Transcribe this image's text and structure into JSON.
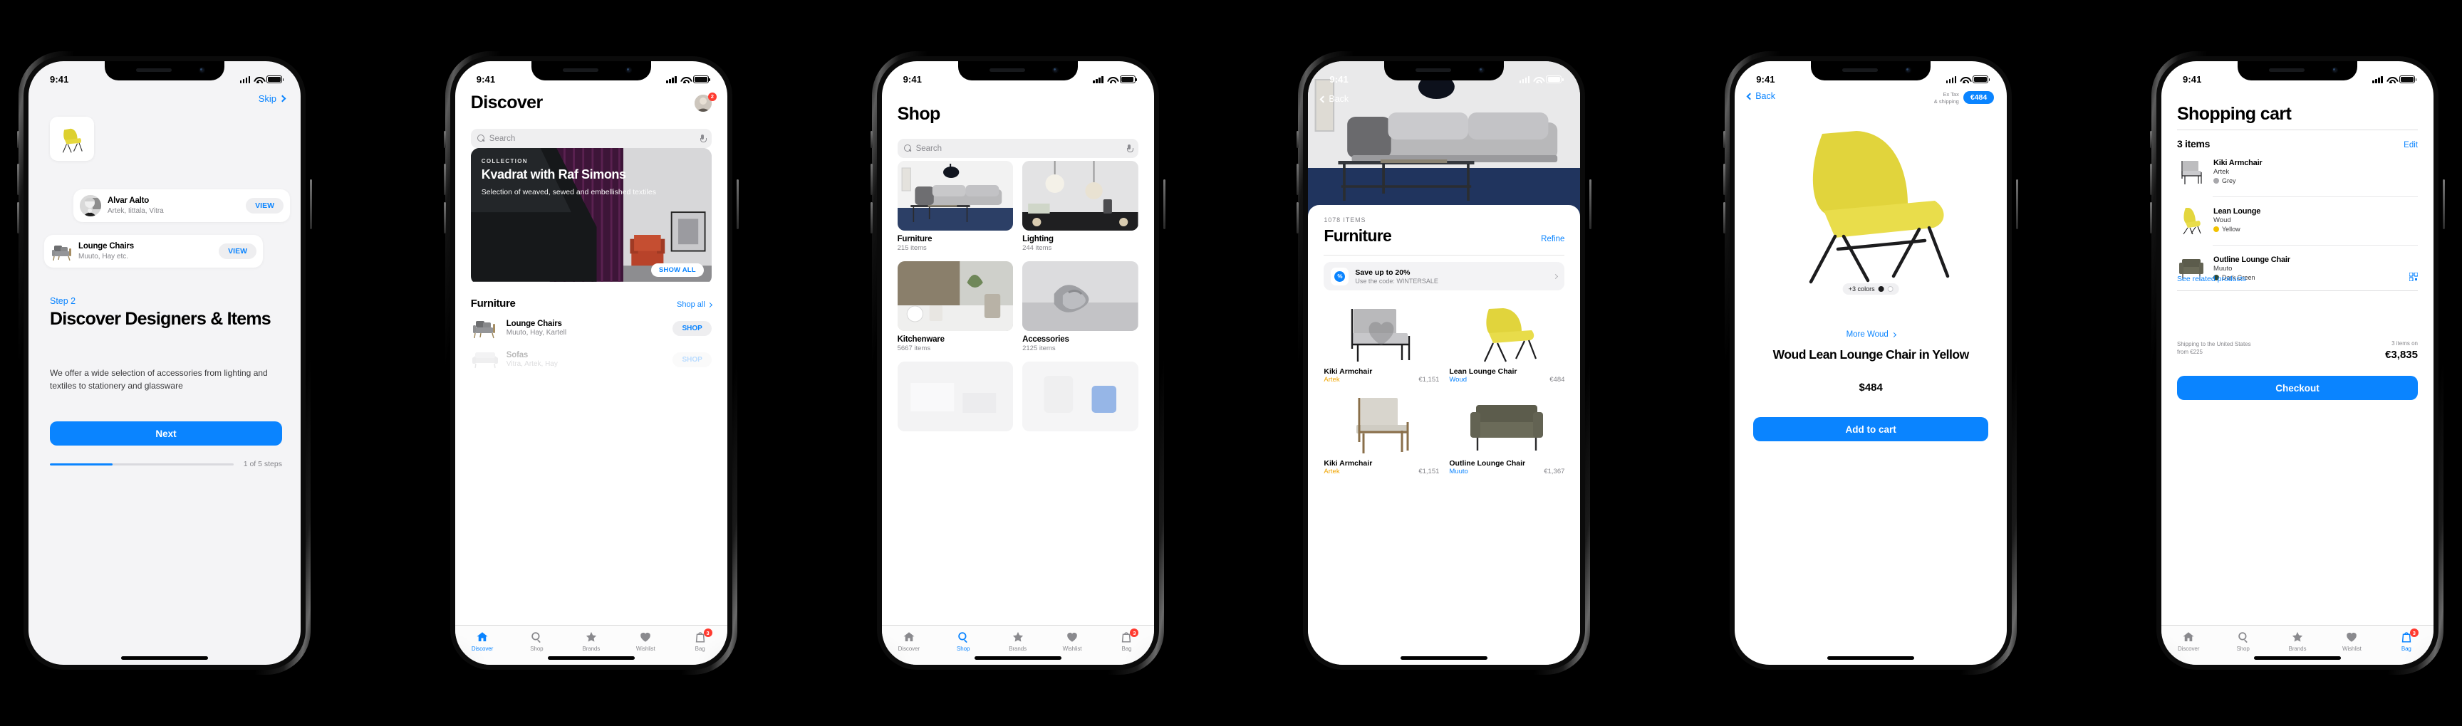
{
  "status": {
    "time": "9:41"
  },
  "phone1": {
    "skip": "Skip",
    "cards": [
      {
        "name": "Alvar Aalto",
        "sub": "Artek, Iittala, Vitra",
        "action": "VIEW"
      },
      {
        "name": "Lounge Chairs",
        "sub": "Muuto, Hay etc.",
        "action": "VIEW"
      }
    ],
    "step": "Step 2",
    "title": "Discover Designers & Items",
    "desc": "We offer a wide selection of accessories from lighting and textiles to stationery and glassware",
    "next": "Next",
    "progress_label": "1 of 5 steps",
    "progress_pct": 34
  },
  "phone2": {
    "title": "Discover",
    "search_placeholder": "Search",
    "avatar_badge": "2",
    "feature": {
      "kicker": "COLLECTION",
      "title": "Kvadrat with Raf Simons",
      "sub": "Selection of weaved, sewed and embellished textiles",
      "cta": "SHOW ALL"
    },
    "section": {
      "title": "Furniture",
      "link": "Shop all"
    },
    "rows": [
      {
        "name": "Lounge Chairs",
        "sub": "Muuto, Hay, Kartell",
        "action": "SHOP"
      },
      {
        "name": "Sofas",
        "sub": "Vitra, Artek, Hay",
        "action": "SHOP"
      }
    ],
    "tabs": [
      {
        "label": "Discover",
        "icon": "home-icon",
        "active": true
      },
      {
        "label": "Shop",
        "icon": "search-icon",
        "active": false
      },
      {
        "label": "Brands",
        "icon": "star-icon",
        "active": false
      },
      {
        "label": "Wishlist",
        "icon": "heart-icon",
        "active": false
      },
      {
        "label": "Bag",
        "icon": "bag-icon",
        "active": false,
        "badge": "3"
      }
    ]
  },
  "phone3": {
    "title": "Shop",
    "search_placeholder": "Search",
    "categories": [
      {
        "name": "Furniture",
        "count": "215 items"
      },
      {
        "name": "Lighting",
        "count": "244 items"
      },
      {
        "name": "Kitchenware",
        "count": "5667 items"
      },
      {
        "name": "Accessories",
        "count": "2125 items"
      }
    ],
    "tabs": [
      {
        "label": "Discover",
        "icon": "home-icon",
        "active": false
      },
      {
        "label": "Shop",
        "icon": "search-icon",
        "active": true
      },
      {
        "label": "Brands",
        "icon": "star-icon",
        "active": false
      },
      {
        "label": "Wishlist",
        "icon": "heart-icon",
        "active": false
      },
      {
        "label": "Bag",
        "icon": "bag-icon",
        "active": false,
        "badge": "3"
      }
    ]
  },
  "phone4": {
    "back": "Back",
    "items_count": "1078 ITEMS",
    "title": "Furniture",
    "refine": "Refine",
    "promo": {
      "title": "Save up to 20%",
      "sub": "Use the code: WINTERSALE"
    },
    "products": [
      {
        "name": "Kiki Armchair",
        "brand": "Artek",
        "price": "€1,151",
        "brand_color": "gold"
      },
      {
        "name": "Lean Lounge Chair",
        "brand": "Woud",
        "price": "€484",
        "brand_color": "blue"
      },
      {
        "name": "Kiki Armchair",
        "brand": "Artek",
        "price": "€1,151",
        "brand_color": "gold"
      },
      {
        "name": "Outline Lounge Chair",
        "brand": "Muuto",
        "price": "€1,367",
        "brand_color": "blue"
      }
    ]
  },
  "phone5": {
    "back": "Back",
    "tax_note": "Ex Tax\n& shipping",
    "price_chip": "€484",
    "colors_label": "+3 colors",
    "more_link": "More Woud",
    "product_title": "Woud Lean Lounge Chair in Yellow",
    "price": "$484",
    "cta": "Add to cart"
  },
  "phone6": {
    "title": "Shopping cart",
    "count": "3 items",
    "edit": "Edit",
    "items": [
      {
        "name": "Kiki Armchair",
        "brand": "Artek",
        "color": "Grey",
        "swatch": "#a8a8ac"
      },
      {
        "name": "Lean Lounge",
        "brand": "Woud",
        "color": "Yellow",
        "swatch": "#f2c200"
      },
      {
        "name": "Outline Lounge Chair",
        "brand": "Muuto",
        "color": "Dark Green",
        "swatch": "#2f4a36"
      }
    ],
    "related": "See related products",
    "shipping": "Shipping to the United States\nfrom €225",
    "total_note": "3 items on",
    "total": "€3,835",
    "checkout": "Checkout",
    "tabs": [
      {
        "label": "Discover",
        "icon": "home-icon",
        "active": false
      },
      {
        "label": "Shop",
        "icon": "search-icon",
        "active": false
      },
      {
        "label": "Brands",
        "icon": "star-icon",
        "active": false
      },
      {
        "label": "Wishlist",
        "icon": "heart-icon",
        "active": false
      },
      {
        "label": "Bag",
        "icon": "bag-icon",
        "active": true,
        "badge": "3"
      }
    ]
  },
  "colors": {
    "accent": "#0a84ff",
    "yellow": "#e3d13a",
    "badge": "#ff3b30"
  }
}
